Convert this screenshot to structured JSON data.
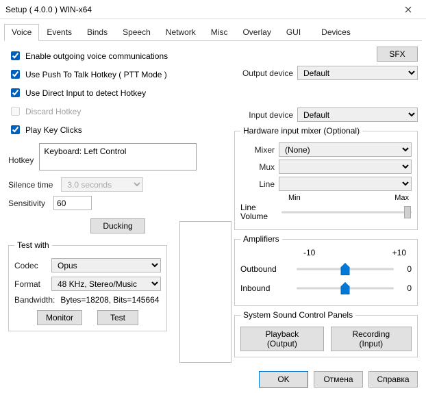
{
  "window": {
    "title": "Setup ( 4.0.0 ) WIN-x64"
  },
  "tabs": [
    "Voice",
    "Events",
    "Binds",
    "Speech",
    "Network",
    "Misc",
    "Overlay",
    "GUI",
    "Devices"
  ],
  "left": {
    "chk_outgoing": "Enable outgoing voice communications",
    "chk_ptt": "Use Push To Talk Hotkey ( PTT Mode )",
    "chk_directinput": "Use Direct Input to detect Hotkey",
    "chk_discard": "Discard Hotkey",
    "chk_playclicks": "Play Key Clicks",
    "hotkey_label": "Hotkey",
    "hotkey_value": "Keyboard: Left Control",
    "silence_label": "Silence time",
    "silence_value": "3.0 seconds",
    "sensitivity_label": "Sensitivity",
    "sensitivity_value": "60",
    "ducking_btn": "Ducking",
    "test_legend": "Test with",
    "codec_label": "Codec",
    "codec_value": "Opus",
    "format_label": "Format",
    "format_value": "48 KHz, Stereo/Music",
    "bandwidth_label": "Bandwidth:",
    "bandwidth_value": "Bytes=18208, Bits=145664",
    "monitor_btn": "Monitor",
    "test_btn": "Test"
  },
  "right": {
    "sfx_btn": "SFX",
    "output_label": "Output device",
    "output_value": "Default",
    "input_label": "Input device",
    "input_value": "Default",
    "mixer_legend": "Hardware input mixer (Optional)",
    "mixer_label": "Mixer",
    "mixer_value": "(None)",
    "mux_label": "Mux",
    "mux_value": "",
    "line_label": "Line",
    "line_value": "",
    "vol_min": "Min",
    "vol_max": "Max",
    "linevol_label": "Line Volume",
    "amp_legend": "Amplifiers",
    "amp_min": "-10",
    "amp_max": "+10",
    "outbound_label": "Outbound",
    "outbound_value": "0",
    "inbound_label": "Inbound",
    "inbound_value": "0",
    "sys_legend": "System Sound Control Panels",
    "playback_btn": "Playback (Output)",
    "recording_btn": "Recording (Input)"
  },
  "footer": {
    "ok": "OK",
    "cancel": "Отмена",
    "help": "Справка"
  }
}
